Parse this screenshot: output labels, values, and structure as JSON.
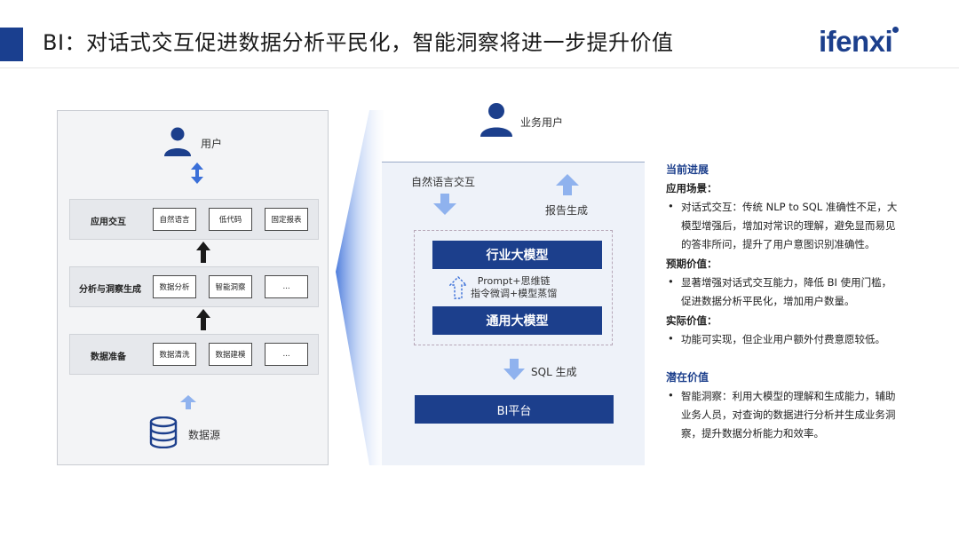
{
  "header": {
    "title": "BI：对话式交互促进数据分析平民化，智能洞察将进一步提升价值",
    "logo": "ifenxi"
  },
  "left_panel": {
    "user_label": "用户",
    "layers": [
      {
        "label": "应用交互",
        "items": [
          "自然语言",
          "低代码",
          "固定报表"
        ]
      },
      {
        "label": "分析与洞察生成",
        "items": [
          "数据分析",
          "智能洞察",
          "..."
        ]
      },
      {
        "label": "数据准备",
        "items": [
          "数据清洗",
          "数据建模",
          "..."
        ]
      }
    ],
    "datasource_label": "数据源"
  },
  "center_panel": {
    "user_label": "业务用户",
    "nl_label": "自然语言交互",
    "report_label": "报告生成",
    "industry_model": "行业大模型",
    "prompt_line1": "Prompt+思维链",
    "prompt_line2": "指令微调+模型蒸馏",
    "general_model": "通用大模型",
    "sql_label": "SQL 生成",
    "bi_platform": "BI平台"
  },
  "right_text": {
    "current_head": "当前进展",
    "scenario_sub": "应用场景：",
    "scenario_lines": [
      "对话式交互：传统 NLP to SQL 准确性不足，大",
      "模型增强后，增加对常识的理解，避免显而易见",
      "的答非所问，提升了用户意图识别准确性。"
    ],
    "expected_sub": "预期价值：",
    "expected_lines": [
      "显著增强对话式交互能力，降低 BI 使用门槛，",
      "促进数据分析平民化，增加用户数量。"
    ],
    "actual_sub": "实际价值：",
    "actual_lines": [
      "功能可实现，但企业用户额外付费意愿较低。"
    ],
    "potential_head": "潜在价值",
    "potential_lines": [
      "智能洞察：利用大模型的理解和生成能力，辅助",
      "业务人员，对查询的数据进行分析并生成业务洞",
      "察，提升数据分析能力和效率。"
    ],
    "bullet": "•"
  },
  "colors": {
    "brand": "#1c3f8c",
    "accent_blue": "#3a6fd8",
    "light_arrow": "#8fb2ee"
  }
}
